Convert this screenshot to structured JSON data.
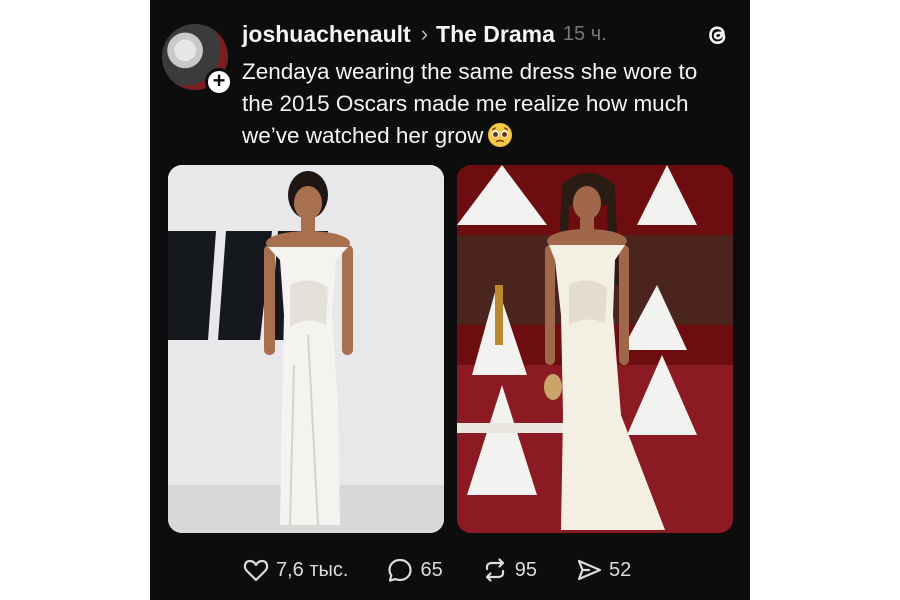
{
  "post": {
    "username": "joshuachenault",
    "community": "The Drama",
    "time": "15 ч.",
    "text": "Zendaya wearing the same dress she wore to the 2015 Oscars made me realize how much we’ve watched her grow"
  },
  "actions": {
    "likes": "7,6 тыс.",
    "replies": "65",
    "reposts": "95",
    "shares": "52"
  },
  "icons": {
    "logo": "threads-logo-icon",
    "emoji": "pleading-face-emoji-icon",
    "like": "heart-icon",
    "reply": "comment-bubble-icon",
    "repost": "repost-arrows-icon",
    "share": "send-arrow-icon"
  },
  "colors": {
    "background": "#0d0d0d",
    "text": "#f3f5f7",
    "muted": "#777777"
  }
}
